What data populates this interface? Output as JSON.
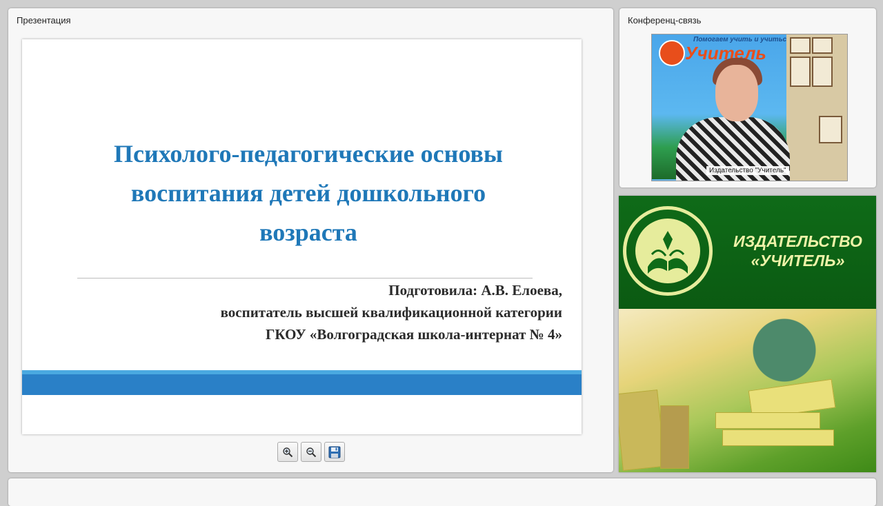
{
  "presentation": {
    "panel_title": "Презентация",
    "slide": {
      "title_lines": [
        "Психолого-педагогические основы",
        "воспитания детей дошкольного",
        "возраста"
      ],
      "author_lines": [
        "Подготовила: А.В. Елоева,",
        "воспитатель высшей квалификационной категории",
        "ГКОУ «Волгоградская школа-интернат № 4»"
      ]
    },
    "toolbar": {
      "zoom_in_icon": "zoom-in-icon",
      "zoom_out_icon": "zoom-out-icon",
      "save_icon": "floppy-disk-icon"
    }
  },
  "conference": {
    "panel_title": "Конференц-связь",
    "video": {
      "caption": "Издательство \"Учитель\"",
      "backdrop_brand": "Учитель",
      "backdrop_slogan": "Помогаем учить и учиться"
    }
  },
  "publisher": {
    "name_line1": "ИЗДАТЕЛЬСТВО",
    "name_line2": "«УЧИТЕЛЬ»"
  },
  "colors": {
    "slide_title": "#1f78b8",
    "slide_band": "#2a80c7",
    "publisher_green": "#0f6b18",
    "publisher_text": "#eef2a8"
  }
}
